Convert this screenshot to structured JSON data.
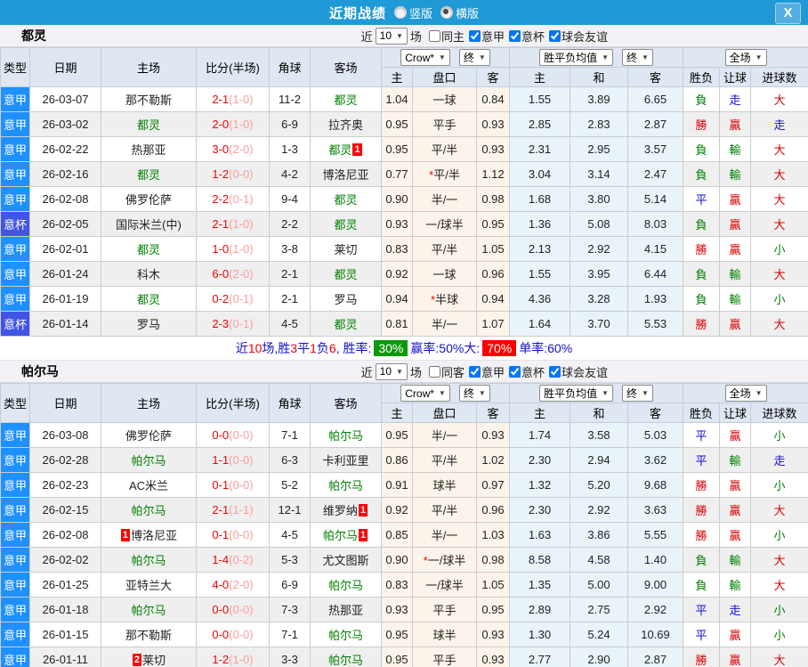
{
  "title": "近期战绩",
  "layout_options": {
    "vertical": "竖版",
    "horizontal": "横版",
    "selected": "横版"
  },
  "icons": {
    "dropdown": "▼",
    "close": "X"
  },
  "controls": {
    "near": "近",
    "count": "10",
    "games": "场",
    "bookmaker": "Crow*",
    "final": "终",
    "avg": "胜平负均值",
    "avg_final": "终",
    "scope": "全场"
  },
  "table_headers": {
    "type": "类型",
    "date": "日期",
    "home": "主场",
    "score": "比分(半场)",
    "corner": "角球",
    "away": "客场",
    "sub": [
      "主",
      "盘口",
      "客",
      "主",
      "和",
      "客",
      "胜负",
      "让球",
      "进球数"
    ]
  },
  "colors": {
    "titlebar": "#1f9ad6",
    "seriea_badge": "#1e90ff",
    "cup_badge": "#4154e4",
    "focus_team": "#008000",
    "score": "#f40000",
    "win": "#dd0000",
    "lose": "#008000",
    "draw": "#0f0fd8",
    "chip_green": "#0b9a0b",
    "chip_red": "#fe0000"
  },
  "sections": [
    {
      "team": "都灵",
      "filters": [
        {
          "label": "同主",
          "checked": false
        },
        {
          "label": "意甲",
          "checked": true
        },
        {
          "label": "意杯",
          "checked": true
        },
        {
          "label": "球会友谊",
          "checked": true
        }
      ],
      "rows": [
        {
          "type": "意甲",
          "date": "26-03-07",
          "home": "那不勒斯",
          "home_focus": false,
          "score": "2-1",
          "half": "(1-0)",
          "corner": "11-2",
          "away": "都灵",
          "away_focus": true,
          "odds": [
            "1.04",
            "一球",
            "0.84"
          ],
          "avg": [
            "1.55",
            "3.89",
            "6.65"
          ],
          "res": [
            "負",
            "走",
            "大"
          ]
        },
        {
          "type": "意甲",
          "date": "26-03-02",
          "home": "都灵",
          "home_focus": true,
          "score": "2-0",
          "half": "(1-0)",
          "corner": "6-9",
          "away": "拉齐奥",
          "away_focus": false,
          "odds": [
            "0.95",
            "平手",
            "0.93"
          ],
          "avg": [
            "2.85",
            "2.83",
            "2.87"
          ],
          "res": [
            "勝",
            "贏",
            "走"
          ]
        },
        {
          "type": "意甲",
          "date": "26-02-22",
          "home": "热那亚",
          "home_focus": false,
          "score": "3-0",
          "half": "(2-0)",
          "corner": "1-3",
          "away": "都灵",
          "away_focus": true,
          "away_badge": "1",
          "odds": [
            "0.95",
            "平/半",
            "0.93"
          ],
          "avg": [
            "2.31",
            "2.95",
            "3.57"
          ],
          "res": [
            "負",
            "輸",
            "大"
          ]
        },
        {
          "type": "意甲",
          "date": "26-02-16",
          "home": "都灵",
          "home_focus": true,
          "score": "1-2",
          "half": "(0-0)",
          "corner": "4-2",
          "away": "博洛尼亚",
          "away_focus": false,
          "odds": [
            "0.77",
            "*平/半",
            "1.12"
          ],
          "avg": [
            "3.04",
            "3.14",
            "2.47"
          ],
          "res": [
            "負",
            "輸",
            "大"
          ]
        },
        {
          "type": "意甲",
          "date": "26-02-08",
          "home": "佛罗伦萨",
          "home_focus": false,
          "score": "2-2",
          "half": "(0-1)",
          "corner": "9-4",
          "away": "都灵",
          "away_focus": true,
          "odds": [
            "0.90",
            "半/一",
            "0.98"
          ],
          "avg": [
            "1.68",
            "3.80",
            "5.14"
          ],
          "res": [
            "平",
            "贏",
            "大"
          ]
        },
        {
          "type": "意杯",
          "date": "26-02-05",
          "home": "国际米兰(中)",
          "home_focus": false,
          "score": "2-1",
          "half": "(1-0)",
          "corner": "2-2",
          "away": "都灵",
          "away_focus": true,
          "odds": [
            "0.93",
            "一/球半",
            "0.95"
          ],
          "avg": [
            "1.36",
            "5.08",
            "8.03"
          ],
          "res": [
            "負",
            "贏",
            "大"
          ]
        },
        {
          "type": "意甲",
          "date": "26-02-01",
          "home": "都灵",
          "home_focus": true,
          "score": "1-0",
          "half": "(1-0)",
          "corner": "3-8",
          "away": "莱切",
          "away_focus": false,
          "odds": [
            "0.83",
            "平/半",
            "1.05"
          ],
          "avg": [
            "2.13",
            "2.92",
            "4.15"
          ],
          "res": [
            "勝",
            "贏",
            "小"
          ]
        },
        {
          "type": "意甲",
          "date": "26-01-24",
          "home": "科木",
          "home_focus": false,
          "score": "6-0",
          "half": "(2-0)",
          "corner": "2-1",
          "away": "都灵",
          "away_focus": true,
          "odds": [
            "0.92",
            "一球",
            "0.96"
          ],
          "avg": [
            "1.55",
            "3.95",
            "6.44"
          ],
          "res": [
            "負",
            "輸",
            "大"
          ]
        },
        {
          "type": "意甲",
          "date": "26-01-19",
          "home": "都灵",
          "home_focus": true,
          "score": "0-2",
          "half": "(0-1)",
          "corner": "2-1",
          "away": "罗马",
          "away_focus": false,
          "odds": [
            "0.94",
            "*半球",
            "0.94"
          ],
          "avg": [
            "4.36",
            "3.28",
            "1.93"
          ],
          "res": [
            "負",
            "輸",
            "小"
          ]
        },
        {
          "type": "意杯",
          "date": "26-01-14",
          "home": "罗马",
          "home_focus": false,
          "score": "2-3",
          "half": "(0-1)",
          "corner": "4-5",
          "away": "都灵",
          "away_focus": true,
          "odds": [
            "0.81",
            "半/一",
            "1.07"
          ],
          "avg": [
            "1.64",
            "3.70",
            "5.53"
          ],
          "res": [
            "勝",
            "贏",
            "大"
          ]
        }
      ],
      "stats": [
        {
          "text": "近",
          "color": "blue"
        },
        {
          "text": "10",
          "color": "red"
        },
        {
          "text": "场,胜",
          "color": "blue"
        },
        {
          "text": "3",
          "color": "red"
        },
        {
          "text": "平",
          "color": "blue"
        },
        {
          "text": "1",
          "color": "red"
        },
        {
          "text": "负",
          "color": "blue"
        },
        {
          "text": "6",
          "color": "red"
        },
        {
          "text": ", 胜率: ",
          "color": "blue"
        },
        {
          "text": "30%",
          "chip": "chip-green"
        },
        {
          "text": " 赢率:",
          "color": "blue"
        },
        {
          "text": "50%",
          "color": "blue"
        },
        {
          "text": " 大: ",
          "color": "blue"
        },
        {
          "text": "70%",
          "chip": "chip-red"
        },
        {
          "text": " 单率:",
          "color": "blue"
        },
        {
          "text": "60%",
          "color": "blue"
        }
      ]
    },
    {
      "team": "帕尔马",
      "filters": [
        {
          "label": "同客",
          "checked": false
        },
        {
          "label": "意甲",
          "checked": true
        },
        {
          "label": "意杯",
          "checked": true
        },
        {
          "label": "球会友谊",
          "checked": true
        }
      ],
      "rows": [
        {
          "type": "意甲",
          "date": "26-03-08",
          "home": "佛罗伦萨",
          "home_focus": false,
          "score": "0-0",
          "half": "(0-0)",
          "corner": "7-1",
          "away": "帕尔马",
          "away_focus": true,
          "odds": [
            "0.95",
            "半/一",
            "0.93"
          ],
          "avg": [
            "1.74",
            "3.58",
            "5.03"
          ],
          "res": [
            "平",
            "贏",
            "小"
          ]
        },
        {
          "type": "意甲",
          "date": "26-02-28",
          "home": "帕尔马",
          "home_focus": true,
          "score": "1-1",
          "half": "(0-0)",
          "corner": "6-3",
          "away": "卡利亚里",
          "away_focus": false,
          "odds": [
            "0.86",
            "平/半",
            "1.02"
          ],
          "avg": [
            "2.30",
            "2.94",
            "3.62"
          ],
          "res": [
            "平",
            "輸",
            "走"
          ]
        },
        {
          "type": "意甲",
          "date": "26-02-23",
          "home": "AC米兰",
          "home_focus": false,
          "score": "0-1",
          "half": "(0-0)",
          "corner": "5-2",
          "away": "帕尔马",
          "away_focus": true,
          "odds": [
            "0.91",
            "球半",
            "0.97"
          ],
          "avg": [
            "1.32",
            "5.20",
            "9.68"
          ],
          "res": [
            "勝",
            "贏",
            "小"
          ]
        },
        {
          "type": "意甲",
          "date": "26-02-15",
          "home": "帕尔马",
          "home_focus": true,
          "score": "2-1",
          "half": "(1-1)",
          "corner": "12-1",
          "away": "维罗纳",
          "away_focus": false,
          "away_badge": "1",
          "odds": [
            "0.92",
            "平/半",
            "0.96"
          ],
          "avg": [
            "2.30",
            "2.92",
            "3.63"
          ],
          "res": [
            "勝",
            "贏",
            "大"
          ]
        },
        {
          "type": "意甲",
          "date": "26-02-08",
          "home": "博洛尼亚",
          "home_focus": false,
          "home_badge_pre": "1",
          "score": "0-1",
          "half": "(0-0)",
          "corner": "4-5",
          "away": "帕尔马",
          "away_focus": true,
          "away_badge": "1",
          "odds": [
            "0.85",
            "半/一",
            "1.03"
          ],
          "avg": [
            "1.63",
            "3.86",
            "5.55"
          ],
          "res": [
            "勝",
            "贏",
            "小"
          ]
        },
        {
          "type": "意甲",
          "date": "26-02-02",
          "home": "帕尔马",
          "home_focus": true,
          "score": "1-4",
          "half": "(0-2)",
          "corner": "5-3",
          "away": "尤文图斯",
          "away_focus": false,
          "odds": [
            "0.90",
            "*一/球半",
            "0.98"
          ],
          "avg": [
            "8.58",
            "4.58",
            "1.40"
          ],
          "res": [
            "負",
            "輸",
            "大"
          ]
        },
        {
          "type": "意甲",
          "date": "26-01-25",
          "home": "亚特兰大",
          "home_focus": false,
          "score": "4-0",
          "half": "(2-0)",
          "corner": "6-9",
          "away": "帕尔马",
          "away_focus": true,
          "odds": [
            "0.83",
            "一/球半",
            "1.05"
          ],
          "avg": [
            "1.35",
            "5.00",
            "9.00"
          ],
          "res": [
            "負",
            "輸",
            "大"
          ]
        },
        {
          "type": "意甲",
          "date": "26-01-18",
          "home": "帕尔马",
          "home_focus": true,
          "score": "0-0",
          "half": "(0-0)",
          "corner": "7-3",
          "away": "热那亚",
          "away_focus": false,
          "odds": [
            "0.93",
            "平手",
            "0.95"
          ],
          "avg": [
            "2.89",
            "2.75",
            "2.92"
          ],
          "res": [
            "平",
            "走",
            "小"
          ]
        },
        {
          "type": "意甲",
          "date": "26-01-15",
          "home": "那不勒斯",
          "home_focus": false,
          "score": "0-0",
          "half": "(0-0)",
          "corner": "7-1",
          "away": "帕尔马",
          "away_focus": true,
          "odds": [
            "0.95",
            "球半",
            "0.93"
          ],
          "avg": [
            "1.30",
            "5.24",
            "10.69"
          ],
          "res": [
            "平",
            "贏",
            "小"
          ]
        },
        {
          "type": "意甲",
          "date": "26-01-11",
          "home": "莱切",
          "home_focus": false,
          "home_badge_pre": "2",
          "score": "1-2",
          "half": "(1-0)",
          "corner": "3-3",
          "away": "帕尔马",
          "away_focus": true,
          "odds": [
            "0.95",
            "平手",
            "0.93"
          ],
          "avg": [
            "2.77",
            "2.90",
            "2.87"
          ],
          "res": [
            "勝",
            "贏",
            "大"
          ]
        }
      ]
    }
  ]
}
